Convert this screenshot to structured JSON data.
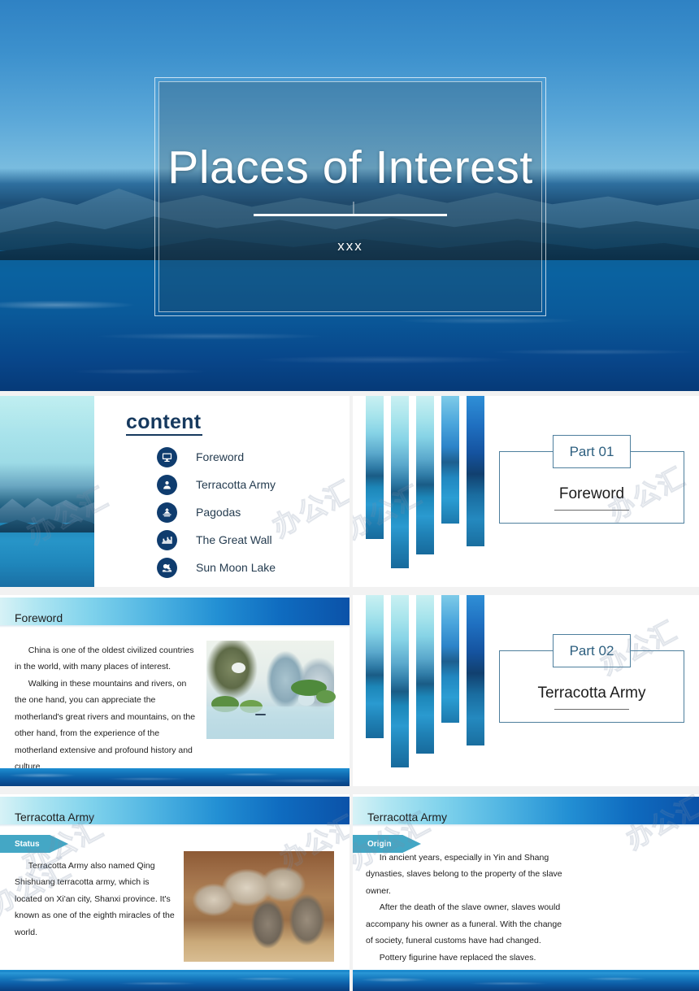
{
  "deck": {
    "watermark_text": "办公汇"
  },
  "slides": {
    "title": {
      "main": "Places of Interest",
      "subtitle": "xxx"
    },
    "content": {
      "heading": "content",
      "items": [
        {
          "label": "Foreword",
          "icon": "monitor-icon"
        },
        {
          "label": "Terracotta Army",
          "icon": "person-icon"
        },
        {
          "label": "Pagodas",
          "icon": "pagoda-icon"
        },
        {
          "label": "The Great Wall",
          "icon": "great-wall-icon"
        },
        {
          "label": "Sun Moon Lake",
          "icon": "sun-moon-lake-icon"
        }
      ]
    },
    "part1": {
      "tag": "Part 01",
      "name": "Foreword"
    },
    "part2": {
      "tag": "Part 02",
      "name": "Terracotta Army"
    },
    "foreword": {
      "header": "Foreword",
      "paragraph1": "China is one of the oldest civilized countries in the world, with many places of interest.",
      "paragraph2": "Walking in these mountains and rivers, on the one hand, you can appreciate the motherland's great rivers and mountains, on the other hand, from the experience of the motherland extensive and profound history and culture."
    },
    "terracotta_status": {
      "header": "Terracotta Army",
      "tag": "Status",
      "paragraph1": "Terracotta Army also named Qing Shishuang terracotta army, which is located on Xi'an city, Shanxi province. It's known as one of the eighth miracles of the world."
    },
    "terracotta_origin": {
      "header": "Terracotta Army",
      "tag": "Origin",
      "paragraph1": "In ancient years, especially in Yin and Shang dynasties, slaves belong to the property of the slave owner.",
      "paragraph2": "After the death of the slave owner, slaves would accompany his owner as a funeral. With the change of society, funeral customs have had changed.",
      "paragraph3": "Pottery figurine have replaced the slaves."
    }
  },
  "colors": {
    "deep_navy": "#0f3c6e",
    "accent_blue": "#2390d4",
    "tag_teal": "#44a7c5",
    "frame_blue": "#4e7f9d",
    "heading_navy": "#16395e"
  }
}
